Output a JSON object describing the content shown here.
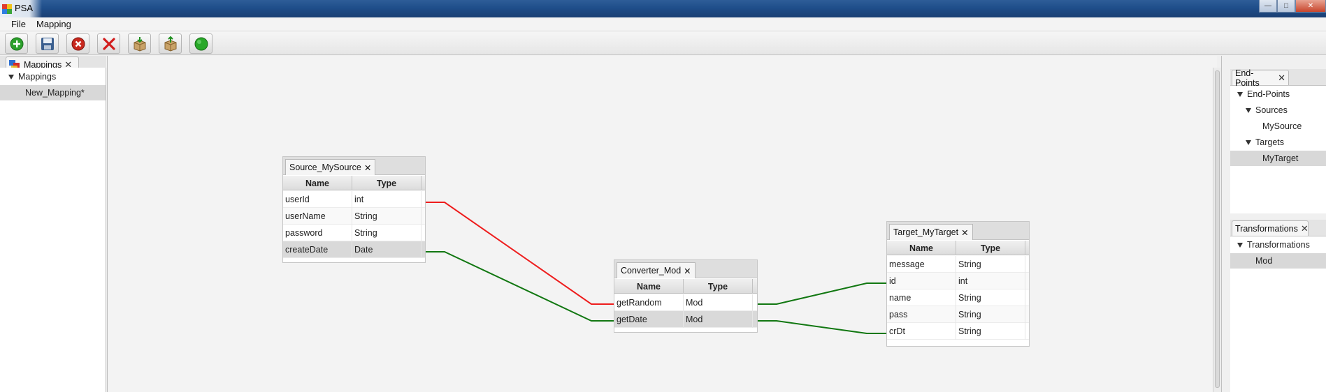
{
  "window": {
    "title": "PSA"
  },
  "menu": {
    "items": [
      "File",
      "Mapping"
    ]
  },
  "toolbar": {
    "buttons": [
      {
        "icon": "add-icon"
      },
      {
        "icon": "save-icon"
      },
      {
        "icon": "close-circle-icon"
      },
      {
        "icon": "delete-icon"
      },
      {
        "icon": "import-box-icon"
      },
      {
        "icon": "export-box-icon"
      },
      {
        "icon": "run-icon"
      }
    ]
  },
  "left_panel": {
    "tab_label": "Mappings",
    "tree": {
      "root": "Mappings",
      "items": [
        "New_Mapping*"
      ]
    }
  },
  "end_points": {
    "tab_label": "End-Points",
    "tree": {
      "root": "End-Points",
      "sources_label": "Sources",
      "sources": [
        "MySource"
      ],
      "targets_label": "Targets",
      "targets": [
        "MyTarget"
      ]
    }
  },
  "transformations": {
    "tab_label": "Transformations",
    "tree": {
      "root": "Transformations",
      "items": [
        "Mod"
      ]
    }
  },
  "columns": {
    "name": "Name",
    "type": "Type"
  },
  "source_table": {
    "tab_label": "Source_MySource",
    "rows": [
      {
        "name": "userId",
        "type": "int"
      },
      {
        "name": "userName",
        "type": "String"
      },
      {
        "name": "password",
        "type": "String"
      },
      {
        "name": "createDate",
        "type": "Date"
      }
    ]
  },
  "converter_table": {
    "tab_label": "Converter_Mod",
    "rows": [
      {
        "name": "getRandom",
        "type": "Mod"
      },
      {
        "name": "getDate",
        "type": "Mod"
      }
    ]
  },
  "target_table": {
    "tab_label": "Target_MyTarget",
    "rows": [
      {
        "name": "message",
        "type": "String"
      },
      {
        "name": "id",
        "type": "int"
      },
      {
        "name": "name",
        "type": "String"
      },
      {
        "name": "pass",
        "type": "String"
      },
      {
        "name": "crDt",
        "type": "String"
      }
    ]
  },
  "colors": {
    "link_red": "#ee1c1c",
    "link_green": "#117711"
  }
}
